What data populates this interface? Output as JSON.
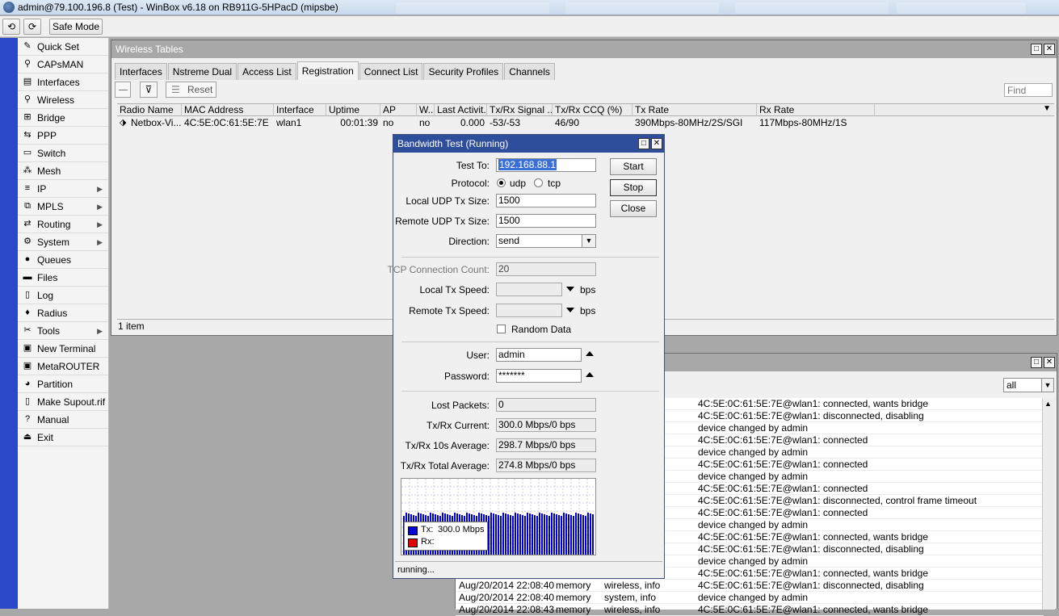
{
  "app": {
    "title": "admin@79.100.196.8 (Test) - WinBox v6.18 on RB911G-5HPacD (mipsbe)"
  },
  "toolbar": {
    "undo_icon": "undo-icon",
    "redo_icon": "redo-icon",
    "safe_mode_label": "Safe Mode"
  },
  "sidebar": {
    "items": [
      {
        "label": "Quick Set",
        "icon": "wand-icon",
        "glyph": "✎",
        "submenu": false
      },
      {
        "label": "CAPsMAN",
        "icon": "antenna-icon",
        "glyph": "⚲",
        "submenu": false
      },
      {
        "label": "Interfaces",
        "icon": "interfaces-icon",
        "glyph": "▤",
        "submenu": false
      },
      {
        "label": "Wireless",
        "icon": "wireless-icon",
        "glyph": "⚲",
        "submenu": false
      },
      {
        "label": "Bridge",
        "icon": "bridge-icon",
        "glyph": "⊞",
        "submenu": false
      },
      {
        "label": "PPP",
        "icon": "ppp-icon",
        "glyph": "⇆",
        "submenu": false
      },
      {
        "label": "Switch",
        "icon": "switch-icon",
        "glyph": "▭",
        "submenu": false
      },
      {
        "label": "Mesh",
        "icon": "mesh-icon",
        "glyph": "⁂",
        "submenu": false
      },
      {
        "label": "IP",
        "icon": "ip-icon",
        "glyph": "≡",
        "submenu": true
      },
      {
        "label": "MPLS",
        "icon": "mpls-icon",
        "glyph": "⧉",
        "submenu": true
      },
      {
        "label": "Routing",
        "icon": "routing-icon",
        "glyph": "⇄",
        "submenu": true
      },
      {
        "label": "System",
        "icon": "gear-icon",
        "glyph": "⚙",
        "submenu": true
      },
      {
        "label": "Queues",
        "icon": "queues-icon",
        "glyph": "●",
        "submenu": false
      },
      {
        "label": "Files",
        "icon": "folder-icon",
        "glyph": "▬",
        "submenu": false
      },
      {
        "label": "Log",
        "icon": "log-icon",
        "glyph": "▯",
        "submenu": false
      },
      {
        "label": "Radius",
        "icon": "radius-icon",
        "glyph": "♦",
        "submenu": false
      },
      {
        "label": "Tools",
        "icon": "tools-icon",
        "glyph": "✂",
        "submenu": true
      },
      {
        "label": "New Terminal",
        "icon": "terminal-icon",
        "glyph": "▣",
        "submenu": false
      },
      {
        "label": "MetaROUTER",
        "icon": "metarouter-icon",
        "glyph": "▣",
        "submenu": false
      },
      {
        "label": "Partition",
        "icon": "partition-icon",
        "glyph": "◕",
        "submenu": false
      },
      {
        "label": "Make Supout.rif",
        "icon": "document-icon",
        "glyph": "▯",
        "submenu": false
      },
      {
        "label": "Manual",
        "icon": "help-icon",
        "glyph": "?",
        "submenu": false
      },
      {
        "label": "Exit",
        "icon": "exit-icon",
        "glyph": "⏏",
        "submenu": false
      }
    ]
  },
  "wireless_window": {
    "title": "Wireless Tables",
    "tabs": [
      "Interfaces",
      "Nstreme Dual",
      "Access List",
      "Registration",
      "Connect List",
      "Security Profiles",
      "Channels"
    ],
    "active_tab": "Registration",
    "reset_label": "Reset",
    "find_placeholder": "Find",
    "columns": [
      "Radio Name",
      "MAC Address",
      "Interface",
      "Uptime",
      "AP",
      "W...",
      "Last Activit...",
      "Tx/Rx Signal ...",
      "Tx/Rx CCQ (%)",
      "Tx Rate",
      "Rx Rate"
    ],
    "rows": [
      {
        "radio_name": "Netbox-Vi...",
        "mac": "4C:5E:0C:61:5E:7E",
        "interface": "wlan1",
        "uptime": "00:01:39",
        "ap": "no",
        "wds": "no",
        "last_activity": "0.000",
        "signal": "-53/-53",
        "ccq": "46/90",
        "tx_rate": "390Mbps-80MHz/2S/SGI",
        "rx_rate": "117Mbps-80MHz/1S"
      }
    ],
    "status": "1 item"
  },
  "log_window": {
    "filter_value": "all",
    "messages": [
      "4C:5E:0C:61:5E:7E@wlan1: connected, wants bridge",
      "4C:5E:0C:61:5E:7E@wlan1: disconnected, disabling",
      "device changed by admin",
      "4C:5E:0C:61:5E:7E@wlan1: connected",
      "device changed by admin",
      "4C:5E:0C:61:5E:7E@wlan1: connected",
      "device changed by admin",
      "4C:5E:0C:61:5E:7E@wlan1: connected",
      "4C:5E:0C:61:5E:7E@wlan1: disconnected, control frame timeout",
      "4C:5E:0C:61:5E:7E@wlan1: connected",
      "device changed by admin",
      "4C:5E:0C:61:5E:7E@wlan1: connected, wants bridge",
      "4C:5E:0C:61:5E:7E@wlan1: disconnected, disabling",
      "device changed by admin",
      "4C:5E:0C:61:5E:7E@wlan1: connected, wants bridge",
      "4C:5E:0C:61:5E:7E@wlan1: disconnected, disabling",
      "device changed by admin",
      "4C:5E:0C:61:5E:7E@wlan1: connected, wants bridge"
    ],
    "full_rows": [
      {
        "time": "Aug/20/2014 22:08:40",
        "buffer": "memory",
        "topics": "wireless, info",
        "row_index": 15
      },
      {
        "time": "Aug/20/2014 22:08:40",
        "buffer": "memory",
        "topics": "system, info",
        "row_index": 16
      },
      {
        "time": "Aug/20/2014 22:08:43",
        "buffer": "memory",
        "topics": "wireless, info",
        "row_index": 17
      }
    ]
  },
  "bandwidth_dialog": {
    "title": "Bandwidth Test (Running)",
    "test_to_label": "Test To:",
    "test_to_value": "192.168.88.1",
    "protocol_label": "Protocol:",
    "protocol_udp": "udp",
    "protocol_tcp": "tcp",
    "protocol_selected": "udp",
    "local_udp_label": "Local UDP Tx Size:",
    "local_udp_value": "1500",
    "remote_udp_label": "Remote UDP Tx Size:",
    "remote_udp_value": "1500",
    "direction_label": "Direction:",
    "direction_value": "send",
    "tcp_count_label": "TCP Connection Count:",
    "tcp_count_value": "20",
    "local_tx_label": "Local Tx Speed:",
    "remote_tx_label": "Remote Tx Speed:",
    "bps_unit": "bps",
    "random_data_label": "Random Data",
    "user_label": "User:",
    "user_value": "admin",
    "password_label": "Password:",
    "password_value": "*******",
    "lost_packets_label": "Lost Packets:",
    "lost_packets_value": "0",
    "current_label": "Tx/Rx Current:",
    "current_value": "300.0 Mbps/0 bps",
    "avg10_label": "Tx/Rx 10s Average:",
    "avg10_value": "298.7 Mbps/0 bps",
    "total_avg_label": "Tx/Rx Total Average:",
    "total_avg_value": "274.8 Mbps/0 bps",
    "legend_tx_label": "Tx:",
    "legend_tx_value": "300.0 Mbps",
    "legend_rx_label": "Rx:",
    "tx_color": "#0000d8",
    "rx_color": "#e00000",
    "start_label": "Start",
    "stop_label": "Stop",
    "close_label": "Close",
    "status": "running..."
  }
}
